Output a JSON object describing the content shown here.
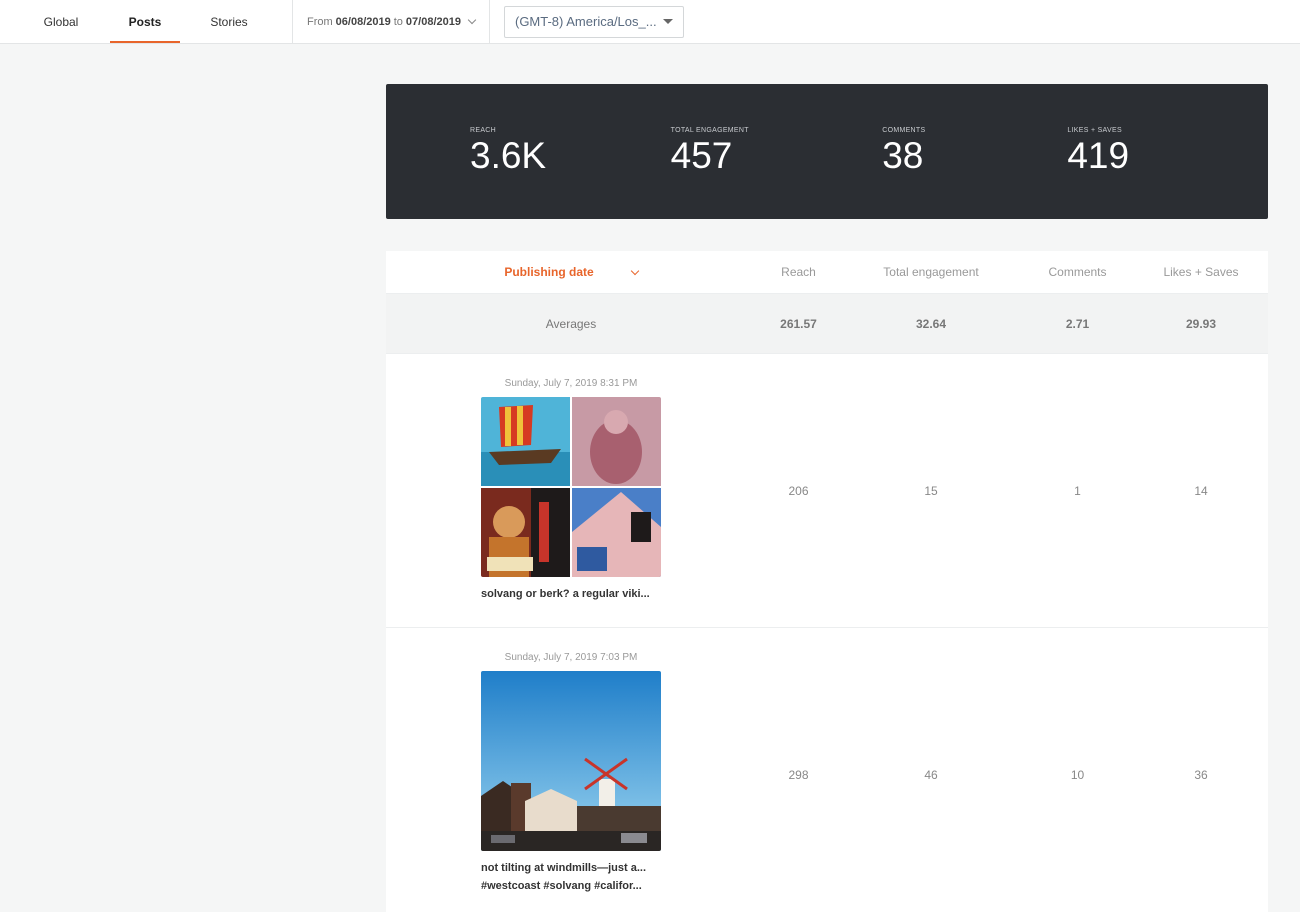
{
  "tabs": [
    {
      "label": "Global",
      "active": false
    },
    {
      "label": "Posts",
      "active": true
    },
    {
      "label": "Stories",
      "active": false
    }
  ],
  "date_range": {
    "prefix": "From",
    "start": "06/08/2019",
    "joiner": "to",
    "end": "07/08/2019"
  },
  "timezone": {
    "selected": "(GMT-8) America/Los_..."
  },
  "stats": [
    {
      "label": "REACH",
      "value": "3.6K"
    },
    {
      "label": "TOTAL ENGAGEMENT",
      "value": "457"
    },
    {
      "label": "COMMENTS",
      "value": "38"
    },
    {
      "label": "LIKES + SAVES",
      "value": "419"
    }
  ],
  "table": {
    "sort_label": "Publishing date",
    "columns": [
      "Reach",
      "Total engagement",
      "Comments",
      "Likes + Saves"
    ],
    "averages": {
      "label": "Averages",
      "values": [
        "261.57",
        "32.64",
        "2.71",
        "29.93"
      ]
    },
    "posts": [
      {
        "date": "Sunday, July 7, 2019 8:31 PM",
        "caption": "solvang or berk? a regular viki...",
        "caption2": "",
        "values": [
          "206",
          "15",
          "1",
          "14"
        ]
      },
      {
        "date": "Sunday, July 7, 2019 7:03 PM",
        "caption": "not tilting at windmills—just a...",
        "caption2": "#westcoast #solvang #califor...",
        "values": [
          "298",
          "46",
          "10",
          "36"
        ]
      }
    ]
  },
  "colors": {
    "accent": "#e8652b",
    "banner": "#2b2e33"
  }
}
